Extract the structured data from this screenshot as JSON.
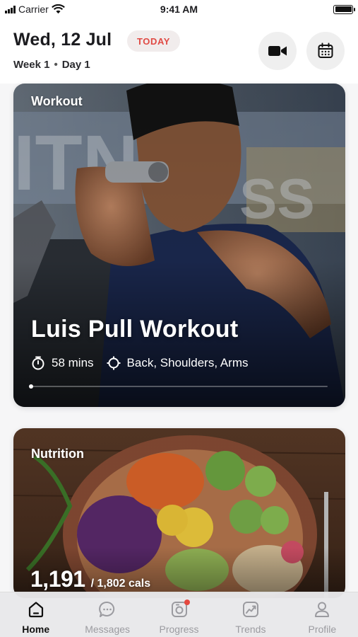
{
  "status_bar": {
    "carrier": "Carrier",
    "time": "9:41 AM"
  },
  "header": {
    "date": "Wed, 12 Jul",
    "today_badge": "TODAY",
    "week": "Week 1",
    "separator": "•",
    "day": "Day 1",
    "video_icon": "video-camera-icon",
    "calendar_icon": "calendar-icon"
  },
  "workout_card": {
    "label": "Workout",
    "title": "Luis Pull Workout",
    "duration": "58 mins",
    "duration_icon": "stopwatch-icon",
    "target_muscles": "Back, Shoulders, Arms",
    "target_icon": "crosshair-icon",
    "progress": 0.0
  },
  "nutrition_card": {
    "label": "Nutrition",
    "calories_consumed": "1,191",
    "calories_goal": "/ 1,802 cals"
  },
  "tab_bar": {
    "tabs": [
      {
        "label": "Home",
        "icon": "home-icon",
        "active": true
      },
      {
        "label": "Messages",
        "icon": "chat-bubble-icon",
        "active": false
      },
      {
        "label": "Progress",
        "icon": "progress-camera-icon",
        "active": false,
        "badge": true
      },
      {
        "label": "Trends",
        "icon": "trend-chart-icon",
        "active": false
      },
      {
        "label": "Profile",
        "icon": "person-icon",
        "active": false
      }
    ]
  },
  "colors": {
    "accent_red": "#e04a44",
    "active_tab": "#111111",
    "inactive_tab": "#9b9ba0"
  }
}
